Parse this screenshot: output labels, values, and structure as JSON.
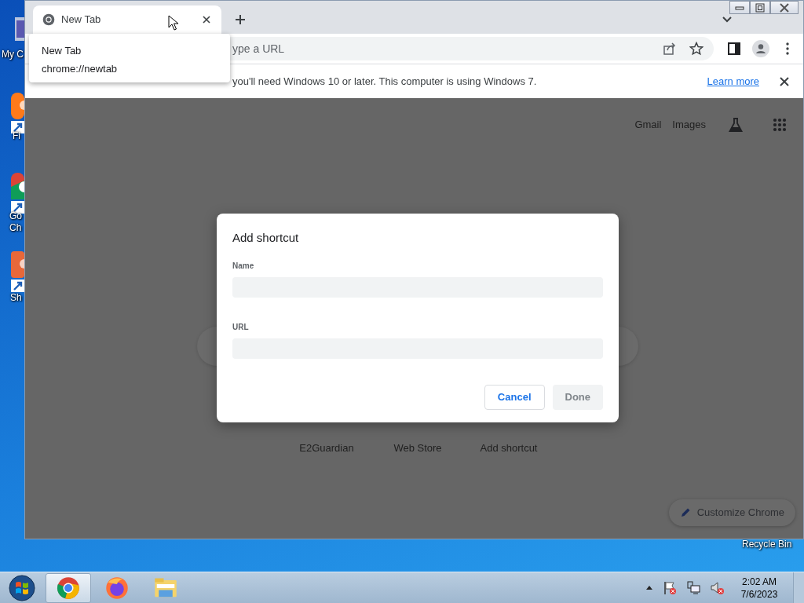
{
  "desktop": {
    "icons": [
      {
        "lines": [
          "My C"
        ]
      },
      {
        "lines": [
          "Fi"
        ]
      },
      {
        "lines": [
          "Go",
          "Ch"
        ]
      },
      {
        "lines": [
          "Sh"
        ]
      },
      {
        "lines": [
          "Recycle Bin"
        ]
      }
    ]
  },
  "browser": {
    "tabs": [
      {
        "title": "New Tab",
        "selected": true
      }
    ],
    "tooltip": {
      "title": "New Tab",
      "url": "chrome://newtab"
    },
    "omnibox": {
      "placeholder": "ype a URL"
    },
    "infobar": {
      "message": "you'll need Windows 10 or later. This computer is using Windows 7.",
      "link": "Learn more"
    },
    "ntp": {
      "links": [
        "Gmail",
        "Images"
      ],
      "shortcuts": [
        {
          "label": "E2Guardian"
        },
        {
          "label": "Web Store"
        },
        {
          "label": "Add shortcut"
        }
      ],
      "customize": "Customize Chrome"
    },
    "dialog": {
      "title": "Add shortcut",
      "fields": [
        {
          "label": "Name"
        },
        {
          "label": "URL"
        }
      ],
      "buttons": [
        {
          "label": "Cancel",
          "disabled": false
        },
        {
          "label": "Done",
          "disabled": true
        }
      ]
    }
  },
  "taskbar": {
    "apps": [
      {
        "kind": "chrome",
        "selected": true
      },
      {
        "kind": "firefox",
        "selected": false
      },
      {
        "kind": "explorer",
        "selected": false
      }
    ],
    "time": "2:02 AM",
    "date": "7/6/2023"
  }
}
